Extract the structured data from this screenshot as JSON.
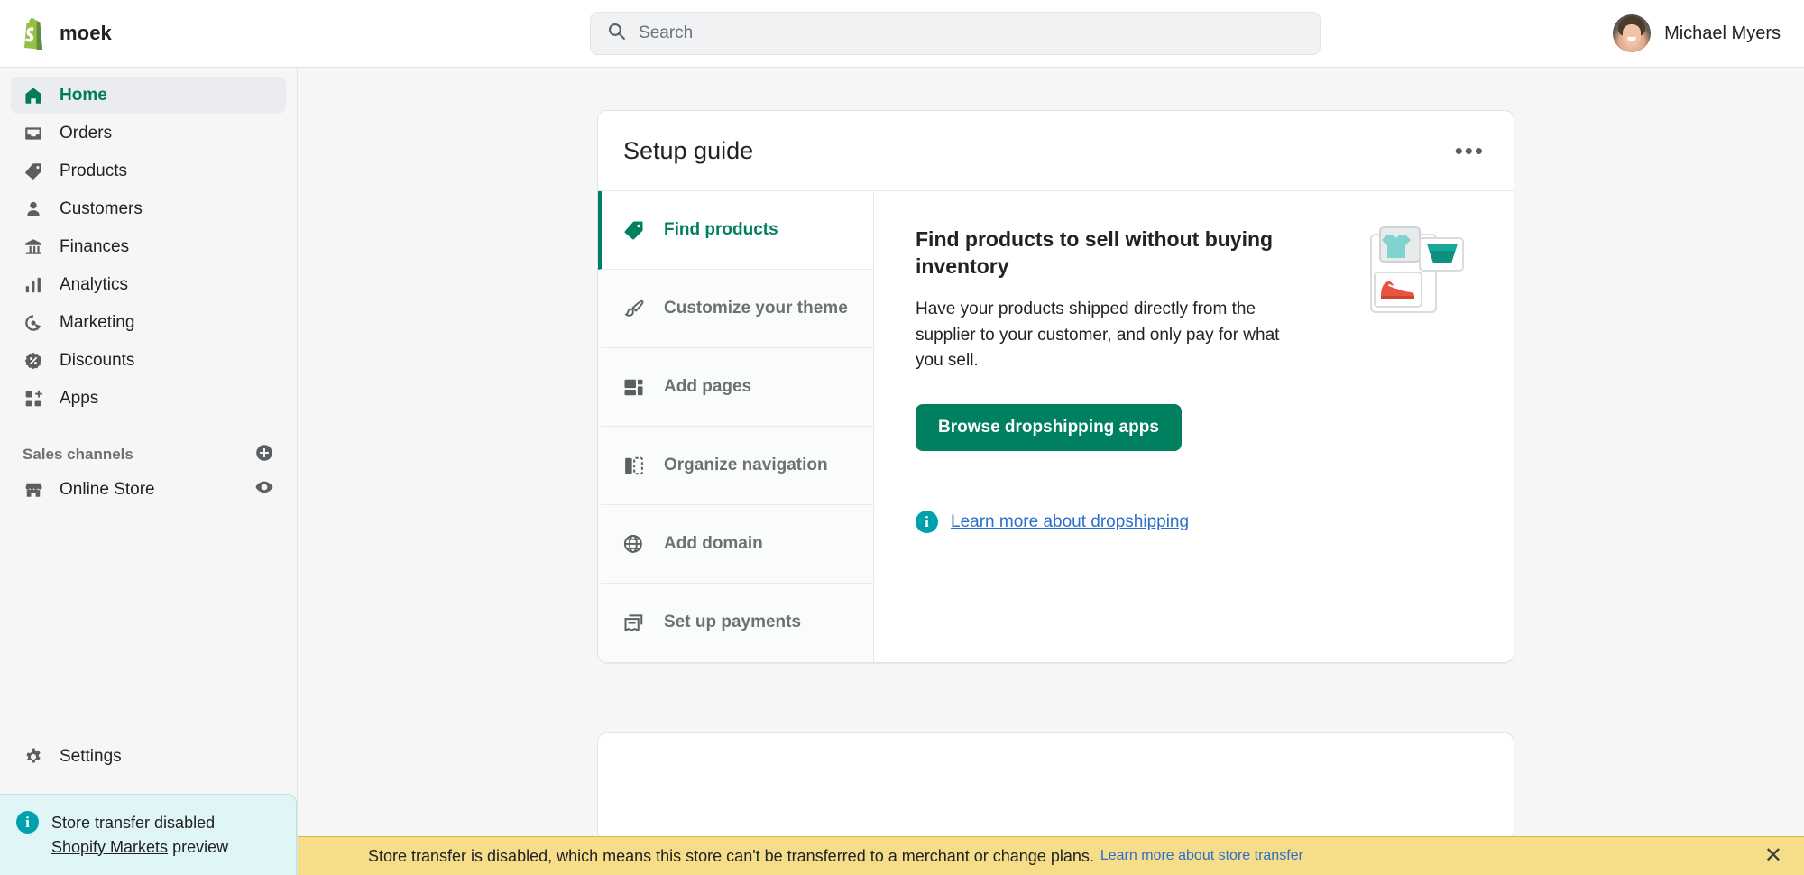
{
  "topbar": {
    "store_name": "moek",
    "logo_icon": "shopify-bag-icon",
    "search": {
      "placeholder": "Search",
      "icon": "search-icon",
      "value": ""
    },
    "user": {
      "name": "Michael Myers",
      "avatar_icon": "user-avatar"
    }
  },
  "sidebar": {
    "items": [
      {
        "label": "Home",
        "icon": "home-icon",
        "active": true
      },
      {
        "label": "Orders",
        "icon": "orders-inbox-icon",
        "active": false
      },
      {
        "label": "Products",
        "icon": "product-tag-icon",
        "active": false
      },
      {
        "label": "Customers",
        "icon": "person-icon",
        "active": false
      },
      {
        "label": "Finances",
        "icon": "bank-icon",
        "active": false
      },
      {
        "label": "Analytics",
        "icon": "bar-chart-icon",
        "active": false
      },
      {
        "label": "Marketing",
        "icon": "marketing-target-icon",
        "active": false
      },
      {
        "label": "Discounts",
        "icon": "discount-percent-icon",
        "active": false
      },
      {
        "label": "Apps",
        "icon": "apps-grid-plus-icon",
        "active": false
      }
    ],
    "sales_channels": {
      "title": "Sales channels",
      "add_icon": "plus-circle-icon",
      "channels": [
        {
          "label": "Online Store",
          "icon": "storefront-icon",
          "action_icon": "eye-icon"
        }
      ]
    },
    "settings": {
      "label": "Settings",
      "icon": "gear-icon"
    },
    "store_notice": {
      "icon": "info-icon",
      "line1": "Store transfer disabled",
      "link_text": "Shopify Markets",
      "line2_suffix": " preview"
    }
  },
  "setup_guide": {
    "title": "Setup guide",
    "menu_icon": "more-horizontal-icon",
    "tabs": [
      {
        "label": "Find products",
        "icon": "product-tag-icon",
        "active": true
      },
      {
        "label": "Customize your theme",
        "icon": "paintbrush-icon",
        "active": false
      },
      {
        "label": "Add pages",
        "icon": "page-layout-icon",
        "active": false
      },
      {
        "label": "Organize navigation",
        "icon": "navigation-panel-icon",
        "active": false
      },
      {
        "label": "Add domain",
        "icon": "globe-icon",
        "active": false
      },
      {
        "label": "Set up payments",
        "icon": "payment-card-icon",
        "active": false
      }
    ],
    "pane": {
      "heading": "Find products to sell without buying inventory",
      "description": "Have your products shipped directly from the supplier to your customer, and only pay for what you sell.",
      "primary_button": "Browse dropshipping apps",
      "learn_icon": "info-icon",
      "learn_link": "Learn more about dropshipping",
      "illustration_icon": "products-illustration"
    }
  },
  "bottom_banner": {
    "message": "Store transfer is disabled, which means this store can't be transferred to a merchant or change plans.",
    "link_text": "Learn more about store transfer",
    "close_icon": "close-icon",
    "close_glyph": "✕",
    "background_color": "#f6dd8a"
  },
  "colors": {
    "brand_green": "#008060",
    "active_green": "#007b5c",
    "link_blue": "#2c6ecb",
    "info_teal": "#00a0ac",
    "banner_yellow": "#f6dd8a"
  }
}
